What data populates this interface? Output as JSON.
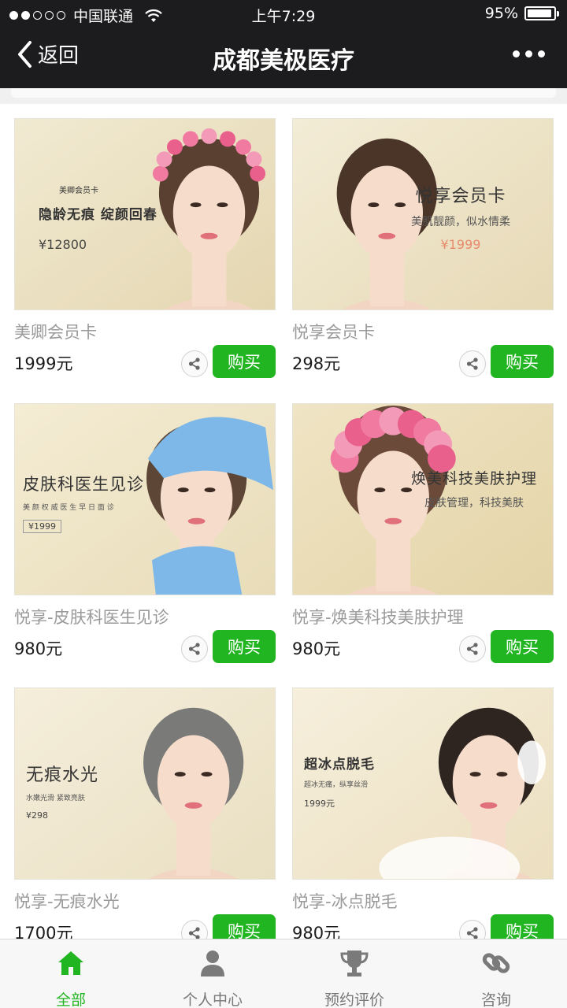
{
  "status_bar": {
    "carrier": "中国联通",
    "time": "上午7:29",
    "battery": "95%",
    "battery_level": 0.95,
    "signal_bars": 2
  },
  "nav": {
    "back_label": "返回",
    "title": "成都美极医疗",
    "more_icon": "more-dots-icon"
  },
  "products": [
    {
      "name": "美卿会员卡",
      "price": "1999元",
      "buy_label": "购买",
      "share_icon": "share-icon",
      "promo": {
        "small": "美卿会员卡",
        "headline": "隐龄无痕 绽颜回春",
        "price": "¥12800"
      },
      "bg": [
        "#f1ead2",
        "#e4d6b0"
      ]
    },
    {
      "name": "悦享会员卡",
      "price": "298元",
      "buy_label": "购买",
      "share_icon": "share-icon",
      "promo": {
        "headline": "悦享会员卡",
        "sub": "美肌靓颜，似水情柔",
        "price": "¥1999"
      },
      "bg": [
        "#f3ecd6",
        "#e6d9b6"
      ]
    },
    {
      "name": "悦享-皮肤科医生见诊",
      "price": "980元",
      "buy_label": "购买",
      "share_icon": "share-icon",
      "promo": {
        "headline": "皮肤科医生见诊",
        "sub": "美 颜 权 威 医 生 早 日 面 诊",
        "price": "¥1999"
      },
      "bg": [
        "#f4ecd4",
        "#e8dcb8"
      ]
    },
    {
      "name": "悦享-焕美科技美肤护理",
      "price": "980元",
      "buy_label": "购买",
      "share_icon": "share-icon",
      "promo": {
        "headline": "焕美科技美肤护理",
        "sub": "皮肤管理，科技美肤"
      },
      "bg": [
        "#efe4c4",
        "#e4d4a8"
      ]
    },
    {
      "name": "悦享-无痕水光",
      "price": "1700元",
      "buy_label": "购买",
      "share_icon": "share-icon",
      "promo": {
        "headline": "无痕水光",
        "sub": "水嫩光滑  紧致亮肤",
        "price": "¥298"
      },
      "bg": [
        "#f5eedb",
        "#e9dfc2"
      ]
    },
    {
      "name": "悦享-冰点脱毛",
      "price": "980元",
      "buy_label": "购买",
      "share_icon": "share-icon",
      "promo": {
        "headline": "超冰点脱毛",
        "sub": "超冰无痛，纵享丝滑",
        "price": "1999元"
      },
      "bg": [
        "#f6efdc",
        "#ecdfc0"
      ]
    }
  ],
  "tabbar": {
    "tabs": [
      {
        "label": "全部",
        "icon": "home-icon",
        "active": true
      },
      {
        "label": "个人中心",
        "icon": "user-icon",
        "active": false
      },
      {
        "label": "预约评价",
        "icon": "trophy-icon",
        "active": false
      },
      {
        "label": "咨询",
        "icon": "link-icon",
        "active": false
      }
    ]
  },
  "colors": {
    "accent_green": "#22b522",
    "nav_bg": "#1c1c1e",
    "muted_text": "#9a9a9a"
  }
}
